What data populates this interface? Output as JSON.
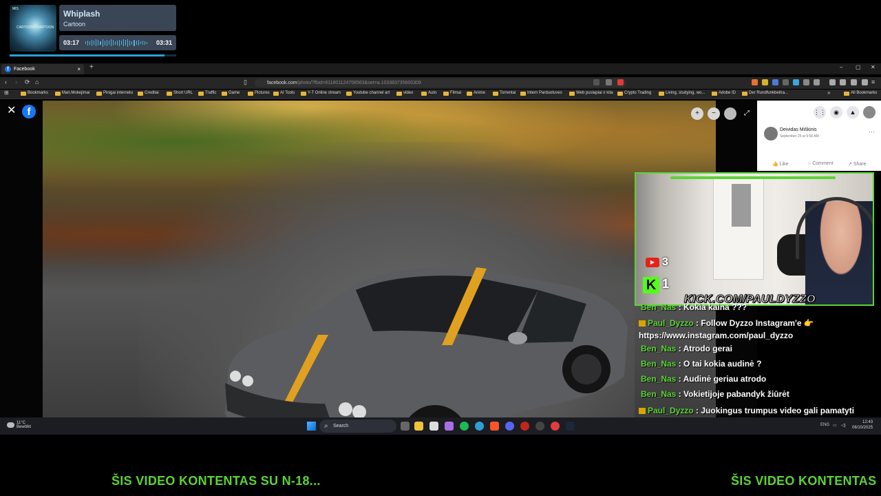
{
  "music": {
    "album_small_text": "MIS",
    "album_caption": "CARTOON · CARTOON",
    "title": "Whiplash",
    "artist": "Cartoon",
    "elapsed": "03:17",
    "total": "03:31",
    "progress": 0.93
  },
  "browser": {
    "tab_title": "Facebook",
    "tab_close": "×",
    "new_tab": "+",
    "win_min": "‒",
    "win_max": "▢",
    "win_close": "✕",
    "url": "facebook.com",
    "url_rest": "/photo/?fbid=811801124758563&set=a.103383735600309",
    "bookmarks": [
      "Bookmarks",
      "Man.Mokejimai",
      "Pinigai internetu",
      "Creditai",
      "Short URL",
      "Traffic",
      "Game",
      "Pictures",
      "AI Tools",
      "Y-T Online stream",
      "Youtube channel art",
      "video",
      "Auto",
      "Filmai",
      "Anime",
      "Torrentai",
      "Intern Parduotuves",
      "Web puslapiai ir kita",
      "Crypto Trading",
      "Living, studying, wo...",
      "Adobe ID",
      "Der Rundfunkbeitra..."
    ],
    "all_bookmarks": "All Bookmarks",
    "more_bookmarks": "»"
  },
  "viewer": {
    "close": "✕",
    "logo": "f",
    "zoom_in": "+",
    "zoom_out": "−",
    "expand": "⤢"
  },
  "post": {
    "author": "Deividas Miškinis",
    "date": "September 25 at 9:58 AM · ",
    "more": "···",
    "like": "Like",
    "comment": "Comment",
    "share": "Share"
  },
  "stream": {
    "yt_viewers": "3",
    "kick_viewers": "1",
    "kick_url": "KICK.COM/PAULDYZZO"
  },
  "chat": [
    {
      "user": "Ben_Nas",
      "text": "Kokia kaina ???",
      "crown": false
    },
    {
      "user": "Paul_Dyzzo",
      "text": "Follow Dyzzo Instagram'e 👉 https://www.instagram.com/paul_dyzzo",
      "crown": true
    },
    {
      "user": "Ben_Nas",
      "text": "Atrodo gerai",
      "crown": false
    },
    {
      "user": "Ben_Nas",
      "text": "O tai kokia audinė ?",
      "crown": false
    },
    {
      "user": "Ben_Nas",
      "text": "Audinė geriau atrodo",
      "crown": false
    },
    {
      "user": "Ben_Nas",
      "text": "Vokietijoje pabandyk žiūrėt",
      "crown": false
    },
    {
      "user": "Paul_Dyzzo",
      "text": "Juokingus trumpus video gali pamatyti per TikTok'ą 👉https://www.tiktok.com/@pauldyzzo",
      "crown": true
    }
  ],
  "taskbar": {
    "temp": "11°C",
    "weather": "Bewölkt",
    "search": "Search",
    "lang": "ENG",
    "time": "12:43",
    "date": "06/10/2025"
  },
  "banner": {
    "text1": "ŠIS VIDEO KONTENTAS SU N-18...",
    "text2": "ŠIS VIDEO KONTENTAS"
  },
  "colors": {
    "kick_green": "#5bd435",
    "facebook_blue": "#1877f2"
  }
}
